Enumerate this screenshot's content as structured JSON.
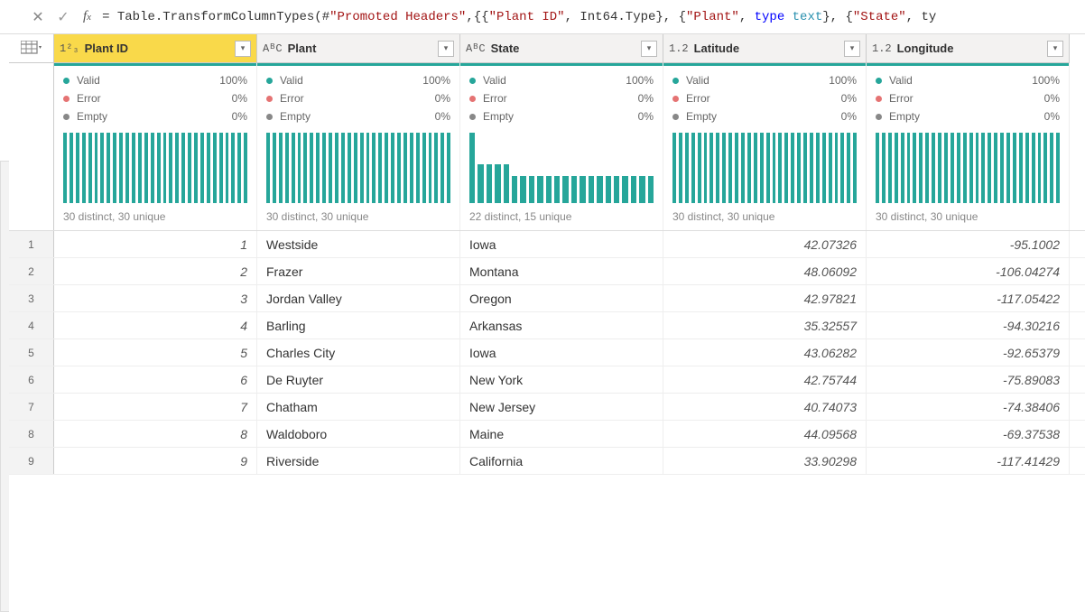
{
  "formula": {
    "prefix": "= Table.TransformColumnTypes(#",
    "s1": "\"Promoted Headers\"",
    "mid1": ",{{",
    "s2": "\"Plant ID\"",
    "mid2": ", Int64.Type}, {",
    "s3": "\"Plant\"",
    "mid3": ", ",
    "kw1": "type",
    "sp1": " ",
    "kw2": "text",
    "mid4": "}, {",
    "s4": "\"State\"",
    "mid5": ", ty"
  },
  "columns": [
    {
      "name": "Plant ID",
      "type_label": "1²₃",
      "selected": true
    },
    {
      "name": "Plant",
      "type_label": "AᴮC",
      "selected": false
    },
    {
      "name": "State",
      "type_label": "AᴮC",
      "selected": false
    },
    {
      "name": "Latitude",
      "type_label": "1.2",
      "selected": false
    },
    {
      "name": "Longitude",
      "type_label": "1.2",
      "selected": false
    }
  ],
  "profile": {
    "labels": {
      "valid": "Valid",
      "error": "Error",
      "empty": "Empty"
    },
    "cells": [
      {
        "valid": "100%",
        "error": "0%",
        "empty": "0%",
        "distinct": "30 distinct, 30 unique",
        "bars": [
          1,
          1,
          1,
          1,
          1,
          1,
          1,
          1,
          1,
          1,
          1,
          1,
          1,
          1,
          1,
          1,
          1,
          1,
          1,
          1,
          1,
          1,
          1,
          1,
          1,
          1,
          1,
          1,
          1,
          1
        ]
      },
      {
        "valid": "100%",
        "error": "0%",
        "empty": "0%",
        "distinct": "30 distinct, 30 unique",
        "bars": [
          1,
          1,
          1,
          1,
          1,
          1,
          1,
          1,
          1,
          1,
          1,
          1,
          1,
          1,
          1,
          1,
          1,
          1,
          1,
          1,
          1,
          1,
          1,
          1,
          1,
          1,
          1,
          1,
          1,
          1
        ]
      },
      {
        "valid": "100%",
        "error": "0%",
        "empty": "0%",
        "distinct": "22 distinct, 15 unique",
        "bars": [
          1,
          0.55,
          0.55,
          0.55,
          0.55,
          0.38,
          0.38,
          0.38,
          0.38,
          0.38,
          0.38,
          0.38,
          0.38,
          0.38,
          0.38,
          0.38,
          0.38,
          0.38,
          0.38,
          0.38,
          0.38,
          0.38
        ]
      },
      {
        "valid": "100%",
        "error": "0%",
        "empty": "0%",
        "distinct": "30 distinct, 30 unique",
        "bars": [
          1,
          1,
          1,
          1,
          1,
          1,
          1,
          1,
          1,
          1,
          1,
          1,
          1,
          1,
          1,
          1,
          1,
          1,
          1,
          1,
          1,
          1,
          1,
          1,
          1,
          1,
          1,
          1,
          1,
          1
        ]
      },
      {
        "valid": "100%",
        "error": "0%",
        "empty": "0%",
        "distinct": "30 distinct, 30 unique",
        "bars": [
          1,
          1,
          1,
          1,
          1,
          1,
          1,
          1,
          1,
          1,
          1,
          1,
          1,
          1,
          1,
          1,
          1,
          1,
          1,
          1,
          1,
          1,
          1,
          1,
          1,
          1,
          1,
          1,
          1,
          1
        ]
      }
    ]
  },
  "rows": [
    {
      "n": "1",
      "id": "1",
      "plant": "Westside",
      "state": "Iowa",
      "lat": "42.07326",
      "lon": "-95.1002"
    },
    {
      "n": "2",
      "id": "2",
      "plant": "Frazer",
      "state": "Montana",
      "lat": "48.06092",
      "lon": "-106.04274"
    },
    {
      "n": "3",
      "id": "3",
      "plant": "Jordan Valley",
      "state": "Oregon",
      "lat": "42.97821",
      "lon": "-117.05422"
    },
    {
      "n": "4",
      "id": "4",
      "plant": "Barling",
      "state": "Arkansas",
      "lat": "35.32557",
      "lon": "-94.30216"
    },
    {
      "n": "5",
      "id": "5",
      "plant": "Charles City",
      "state": "Iowa",
      "lat": "43.06282",
      "lon": "-92.65379"
    },
    {
      "n": "6",
      "id": "6",
      "plant": "De Ruyter",
      "state": "New York",
      "lat": "42.75744",
      "lon": "-75.89083"
    },
    {
      "n": "7",
      "id": "7",
      "plant": "Chatham",
      "state": "New Jersey",
      "lat": "40.74073",
      "lon": "-74.38406"
    },
    {
      "n": "8",
      "id": "8",
      "plant": "Waldoboro",
      "state": "Maine",
      "lat": "44.09568",
      "lon": "-69.37538"
    },
    {
      "n": "9",
      "id": "9",
      "plant": "Riverside",
      "state": "California",
      "lat": "33.90298",
      "lon": "-117.41429"
    }
  ]
}
